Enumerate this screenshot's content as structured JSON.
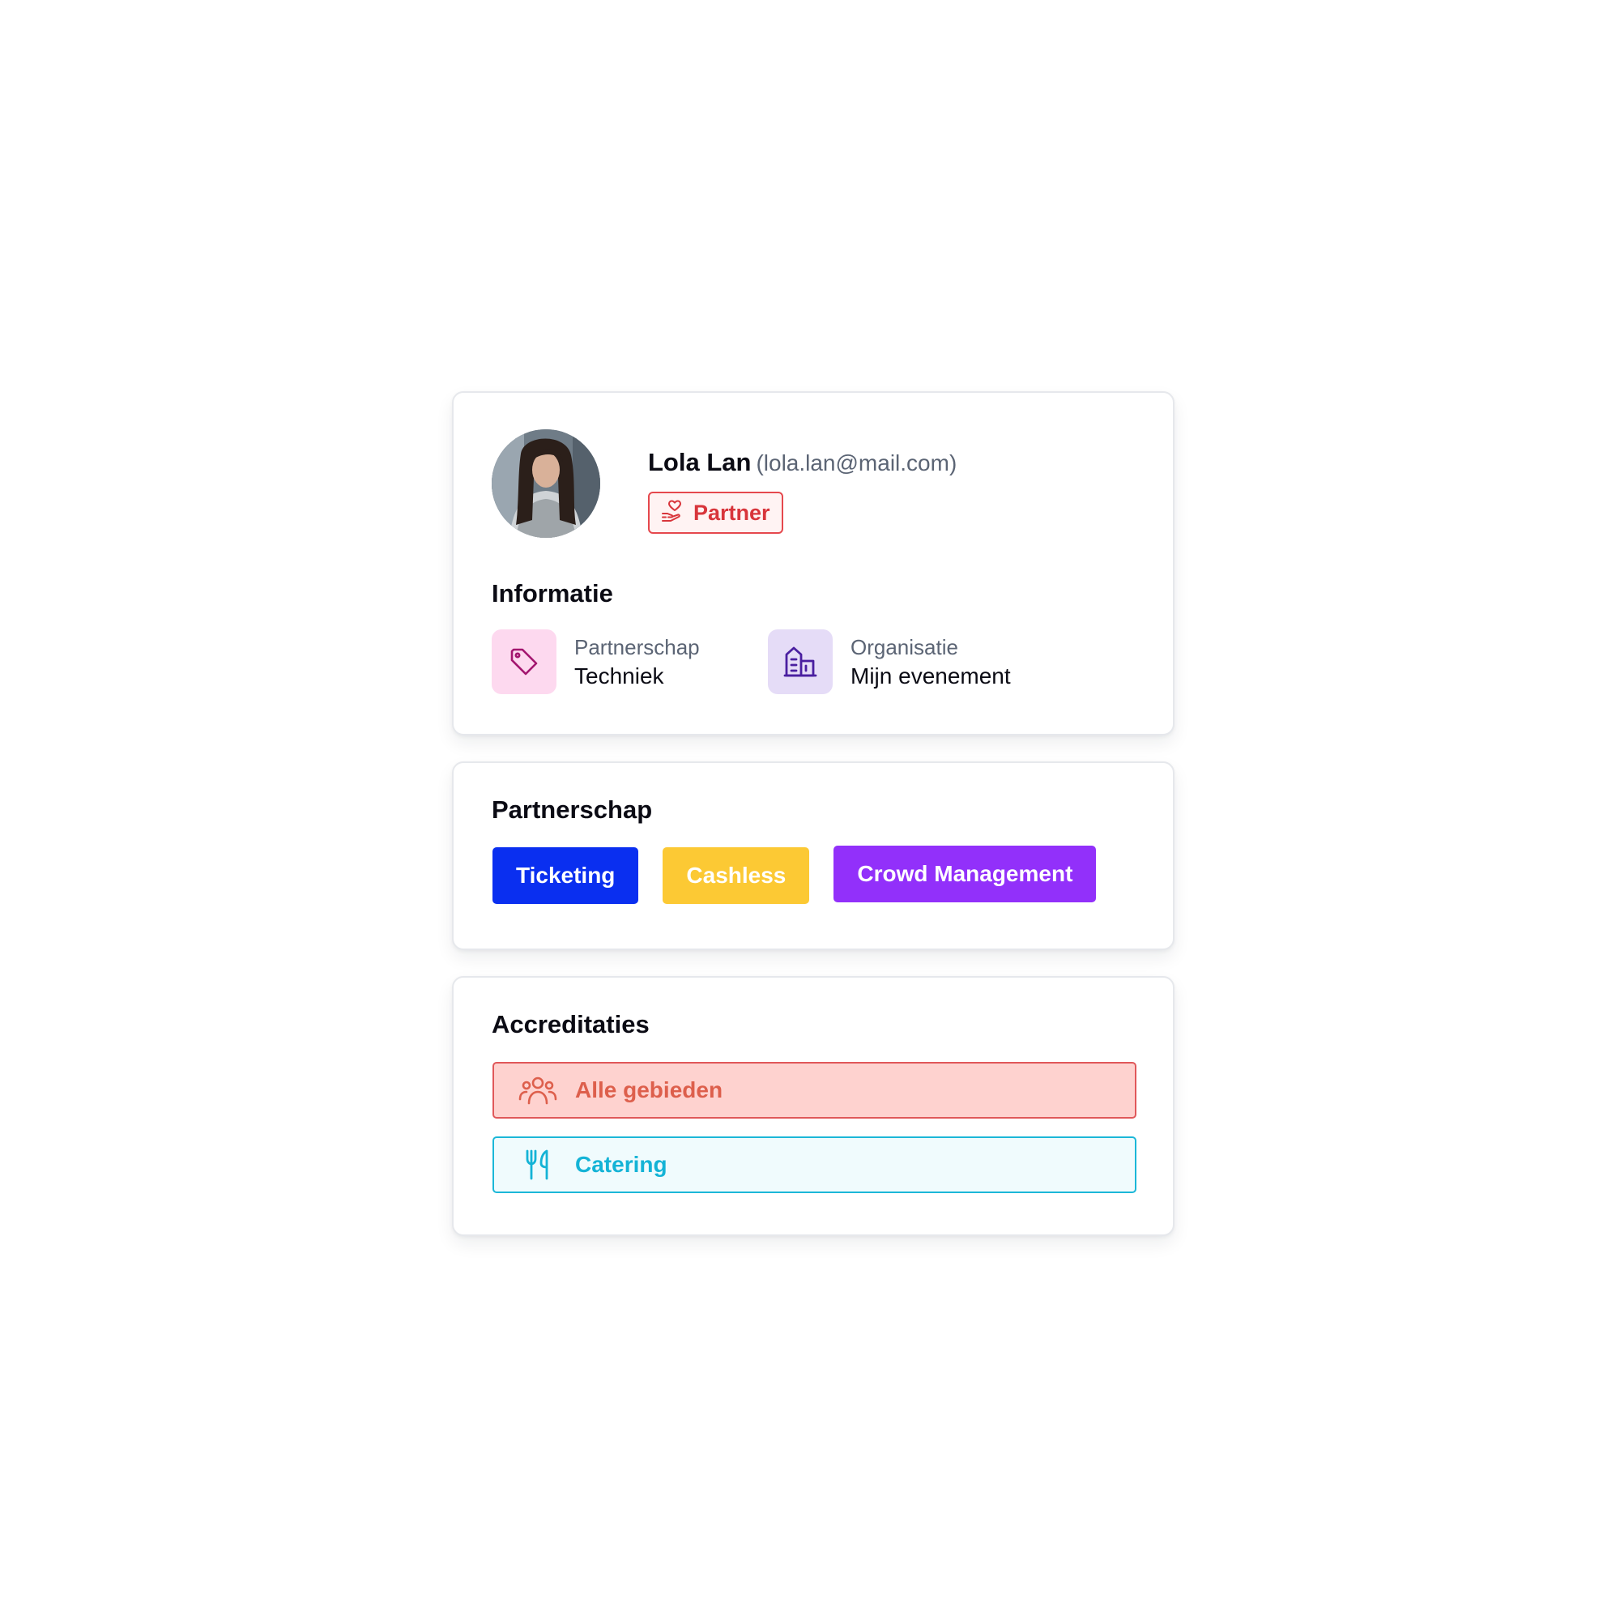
{
  "profile": {
    "name": "Lola Lan",
    "email": "(lola.lan@mail.com)",
    "badge": {
      "label": "Partner",
      "icon": "heart-hand-icon",
      "color": "#e5484d"
    }
  },
  "info": {
    "title": "Informatie",
    "items": [
      {
        "label": "Partnerschap",
        "value": "Techniek",
        "icon": "tag-icon",
        "icon_bg": "#fdd9ef",
        "icon_color": "#a3166f"
      },
      {
        "label": "Organisatie",
        "value": "Mijn evenement",
        "icon": "building-icon",
        "icon_bg": "#e5dcf7",
        "icon_color": "#4a1fa0"
      }
    ]
  },
  "partnership": {
    "title": "Partnerschap",
    "chips": [
      {
        "label": "Ticketing",
        "color": "#0a2ff0"
      },
      {
        "label": "Cashless",
        "color": "#fcc934"
      },
      {
        "label": "Crowd Management",
        "color": "#9230fa"
      }
    ]
  },
  "accreditations": {
    "title": "Accreditaties",
    "items": [
      {
        "label": "Alle gebieden",
        "icon": "users-icon",
        "bg": "#fed2cf",
        "border": "#e0585a",
        "text": "#dd5f4c"
      },
      {
        "label": "Catering",
        "icon": "fork-knife-icon",
        "bg": "#f0fbfd",
        "border": "#1bb7d8",
        "text": "#14b3d6"
      }
    ]
  }
}
